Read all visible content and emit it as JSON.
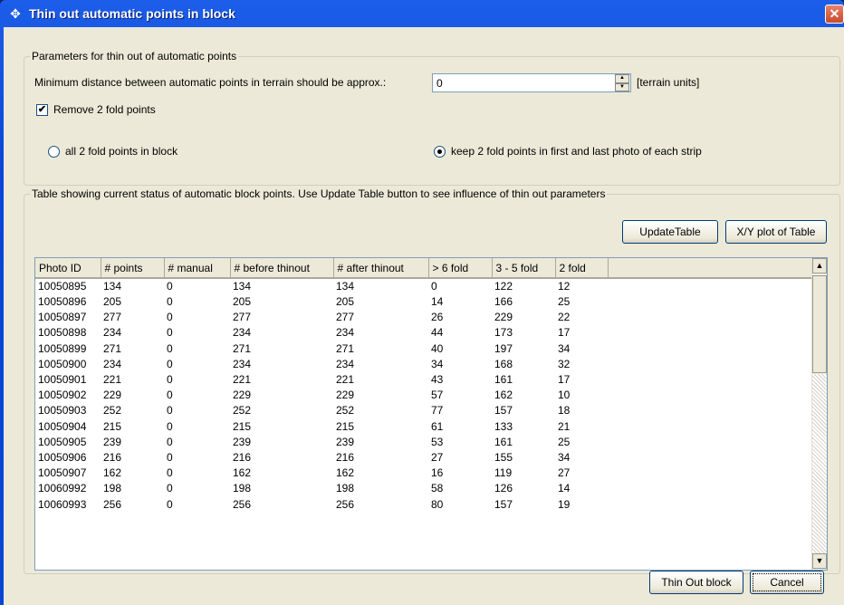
{
  "window": {
    "title": "Thin out automatic points in block",
    "close_glyph": "✕",
    "title_icon": "dialog-app-icon"
  },
  "params": {
    "legend": "Parameters for thin out of automatic points",
    "min_distance_label": "Minimum distance between automatic points in terrain should be approx.:",
    "min_distance_value": "0",
    "units_label": "[terrain units]",
    "remove_checkbox_label": "Remove 2 fold points",
    "remove_checked": true,
    "radio_all_label": "all 2 fold points in block",
    "radio_keep_label": "keep  2 fold points in  first and last photo of each strip",
    "selected_radio": "keep"
  },
  "table_group": {
    "legend": "Table showing current status of automatic block points. Use Update Table button to see influence of thin out parameters",
    "update_button": "UpdateTable",
    "plot_button": "X/Y plot of Table"
  },
  "table": {
    "columns": [
      "Photo ID",
      "# points",
      "# manual",
      "#  before thinout",
      "# after thinout",
      "> 6 fold",
      "3 - 5 fold",
      "2 fold"
    ],
    "rows": [
      [
        "10050895",
        "134",
        "0",
        "134",
        "134",
        "0",
        "122",
        "12"
      ],
      [
        "10050896",
        "205",
        "0",
        "205",
        "205",
        "14",
        "166",
        "25"
      ],
      [
        "10050897",
        "277",
        "0",
        "277",
        "277",
        "26",
        "229",
        "22"
      ],
      [
        "10050898",
        "234",
        "0",
        "234",
        "234",
        "44",
        "173",
        "17"
      ],
      [
        "10050899",
        "271",
        "0",
        "271",
        "271",
        "40",
        "197",
        "34"
      ],
      [
        "10050900",
        "234",
        "0",
        "234",
        "234",
        "34",
        "168",
        "32"
      ],
      [
        "10050901",
        "221",
        "0",
        "221",
        "221",
        "43",
        "161",
        "17"
      ],
      [
        "10050902",
        "229",
        "0",
        "229",
        "229",
        "57",
        "162",
        "10"
      ],
      [
        "10050903",
        "252",
        "0",
        "252",
        "252",
        "77",
        "157",
        "18"
      ],
      [
        "10050904",
        "215",
        "0",
        "215",
        "215",
        "61",
        "133",
        "21"
      ],
      [
        "10050905",
        "239",
        "0",
        "239",
        "239",
        "53",
        "161",
        "25"
      ],
      [
        "10050906",
        "216",
        "0",
        "216",
        "216",
        "27",
        "155",
        "34"
      ],
      [
        "10050907",
        "162",
        "0",
        "162",
        "162",
        "16",
        "119",
        "27"
      ],
      [
        "10060992",
        "198",
        "0",
        "198",
        "198",
        "58",
        "126",
        "14"
      ],
      [
        "10060993",
        "256",
        "0",
        "256",
        "256",
        "80",
        "157",
        "19"
      ]
    ]
  },
  "footer": {
    "thin_out_button": "Thin Out block",
    "cancel_button": "Cancel"
  },
  "colors": {
    "titlebar": "#0845d8",
    "dialog_bg": "#ece9d8",
    "close": "#c84a2a"
  }
}
